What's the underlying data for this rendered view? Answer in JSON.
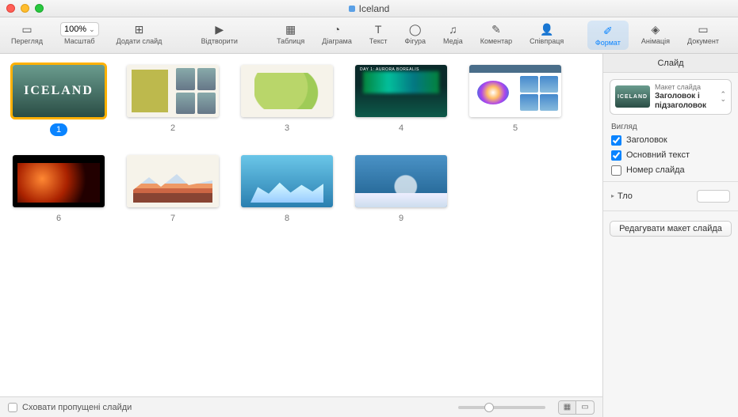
{
  "window": {
    "title": "Iceland"
  },
  "toolbar": {
    "view": "Перегляд",
    "zoom_label": "Масштаб",
    "zoom_value": "100%",
    "add_slide": "Додати слайд",
    "play": "Відтворити",
    "table": "Таблиця",
    "chart": "Діаграма",
    "text": "Текст",
    "shape": "Фігура",
    "media": "Медіа",
    "comment": "Коментар",
    "collaborate": "Співпраця",
    "format": "Формат",
    "animation": "Анімація",
    "document": "Документ"
  },
  "slides": [
    {
      "num": "1",
      "selected": true,
      "preview": "th1",
      "title": "ICELAND"
    },
    {
      "num": "2",
      "selected": false,
      "preview": "th2"
    },
    {
      "num": "3",
      "selected": false,
      "preview": "th3"
    },
    {
      "num": "4",
      "selected": false,
      "preview": "th4"
    },
    {
      "num": "5",
      "selected": false,
      "preview": "th5"
    },
    {
      "num": "6",
      "selected": false,
      "preview": "th6"
    },
    {
      "num": "7",
      "selected": false,
      "preview": "th7"
    },
    {
      "num": "8",
      "selected": false,
      "preview": "th8"
    },
    {
      "num": "9",
      "selected": false,
      "preview": "th9"
    }
  ],
  "statusbar": {
    "hide_skipped": "Сховати пропущені слайди"
  },
  "inspector": {
    "tab": "Слайд",
    "layout_caption": "Макет слайда",
    "layout_name_1": "Заголовок і",
    "layout_name_2": "підзаголовок",
    "appearance": "Вигляд",
    "title_cb": "Заголовок",
    "body_cb": "Основний текст",
    "slidenum_cb": "Номер слайда",
    "background": "Тло",
    "edit_layout": "Редагувати макет слайда"
  }
}
